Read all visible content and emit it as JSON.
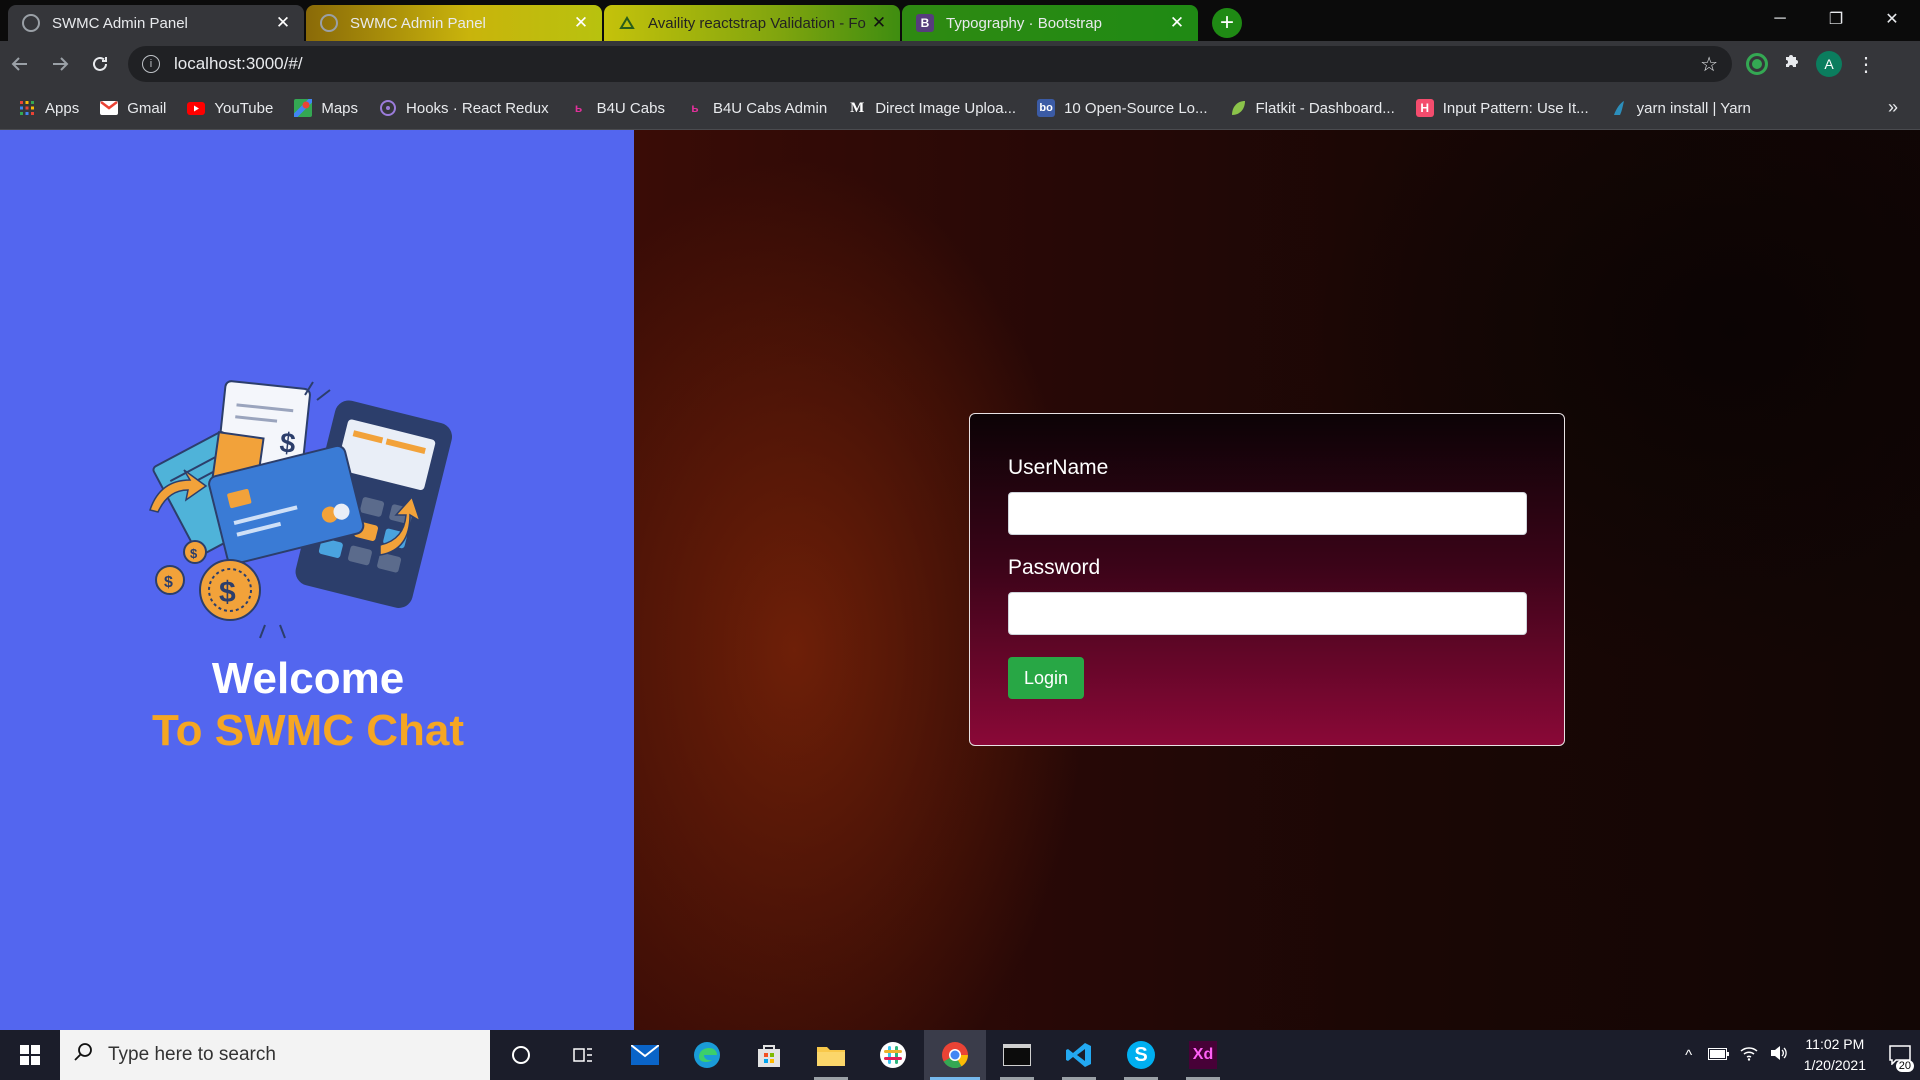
{
  "browser": {
    "tabs": [
      {
        "title": "SWMC Admin Panel",
        "favicon": "circle-loading-icon"
      },
      {
        "title": "SWMC Admin Panel",
        "favicon": "circle-loading-icon"
      },
      {
        "title": "Availity reactstrap Validation - Fo",
        "favicon": "availity-icon"
      },
      {
        "title": "Typography · Bootstrap",
        "favicon": "bootstrap-icon",
        "favicon_text": "B"
      }
    ],
    "close_glyph": "✕",
    "new_tab_glyph": "+",
    "window_controls": {
      "minimize": "─",
      "restore": "❐",
      "close": "✕"
    },
    "url": "localhost:3000/#/",
    "profile_initial": "A"
  },
  "bookmarks": [
    {
      "label": "Apps",
      "icon": "apps-grid-icon"
    },
    {
      "label": "Gmail",
      "icon": "gmail-icon"
    },
    {
      "label": "YouTube",
      "icon": "youtube-icon"
    },
    {
      "label": "Maps",
      "icon": "maps-icon"
    },
    {
      "label": "Hooks · React Redux",
      "icon": "redux-icon"
    },
    {
      "label": "B4U Cabs",
      "icon": "b4u-icon"
    },
    {
      "label": "B4U Cabs Admin",
      "icon": "b4u-icon"
    },
    {
      "label": "Direct Image Uploa...",
      "icon": "medium-icon",
      "icon_text": "M"
    },
    {
      "label": "10 Open-Source Lo...",
      "icon": "bo-icon",
      "icon_text": "bo"
    },
    {
      "label": "Flatkit - Dashboard...",
      "icon": "flatkit-leaf-icon"
    },
    {
      "label": "Input Pattern: Use It...",
      "icon": "h-icon",
      "icon_text": "H"
    },
    {
      "label": "yarn install | Yarn",
      "icon": "yarn-icon"
    }
  ],
  "bookmarks_more": "»",
  "page": {
    "welcome": "Welcome",
    "subtitle": "To SWMC Chat",
    "login": {
      "username_label": "UserName",
      "username_value": "",
      "password_label": "Password",
      "password_value": "",
      "button_label": "Login"
    }
  },
  "taskbar": {
    "search_placeholder": "Type here to search",
    "apps": [
      "cortana-icon",
      "task-view-icon",
      "mail-icon",
      "edge-icon",
      "store-icon",
      "file-explorer-icon",
      "slack-icon",
      "chrome-icon",
      "terminal-icon",
      "vscode-icon",
      "skype-icon",
      "adobe-xd-icon"
    ],
    "skype_letter": "S",
    "xd_text": "Xd",
    "time": "11:02 PM",
    "date": "1/20/2021",
    "notifications": "20"
  },
  "colors": {
    "left_panel": "#5366ef",
    "subtitle": "#f5a623",
    "login_button": "#28a745"
  }
}
